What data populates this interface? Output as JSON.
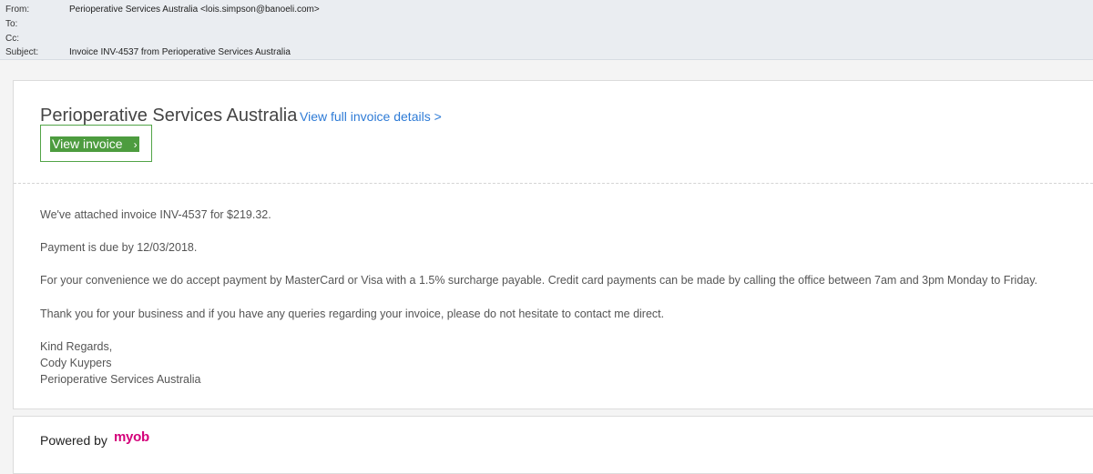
{
  "header": {
    "from_label": "From:",
    "from_value": "Perioperative Services Australia <lois.simpson@banoeli.com>",
    "to_label": "To:",
    "to_value": "",
    "cc_label": "Cc:",
    "cc_value": "",
    "subject_label": "Subject:",
    "subject_value": "Invoice INV-4537 from Perioperative Services Australia"
  },
  "email": {
    "company_name": "Perioperative Services Australia",
    "view_details_link": "View full invoice details >",
    "view_invoice_button": "View invoice",
    "view_invoice_chevron": "›",
    "line1": "We've attached invoice INV-4537 for $219.32.",
    "line2": "Payment is due by 12/03/2018.",
    "line3": "For your convenience we do accept payment by MasterCard or Visa with a 1.5% surcharge payable. Credit card payments can be made by calling the office between 7am and 3pm Monday to Friday.",
    "line4": "Thank you for your business and if you have any queries regarding your invoice, please do not hesitate to contact me direct.",
    "sign_off": "Kind Regards,",
    "sender_name": "Cody Kuypers",
    "sender_company": "Perioperative Services Australia"
  },
  "footer": {
    "powered_by": "Powered by",
    "brand": "myob"
  },
  "colors": {
    "header_bg": "#eaedf1",
    "link": "#2e7bd6",
    "button_green": "#4d9c3f",
    "brand_magenta": "#d4007a"
  }
}
